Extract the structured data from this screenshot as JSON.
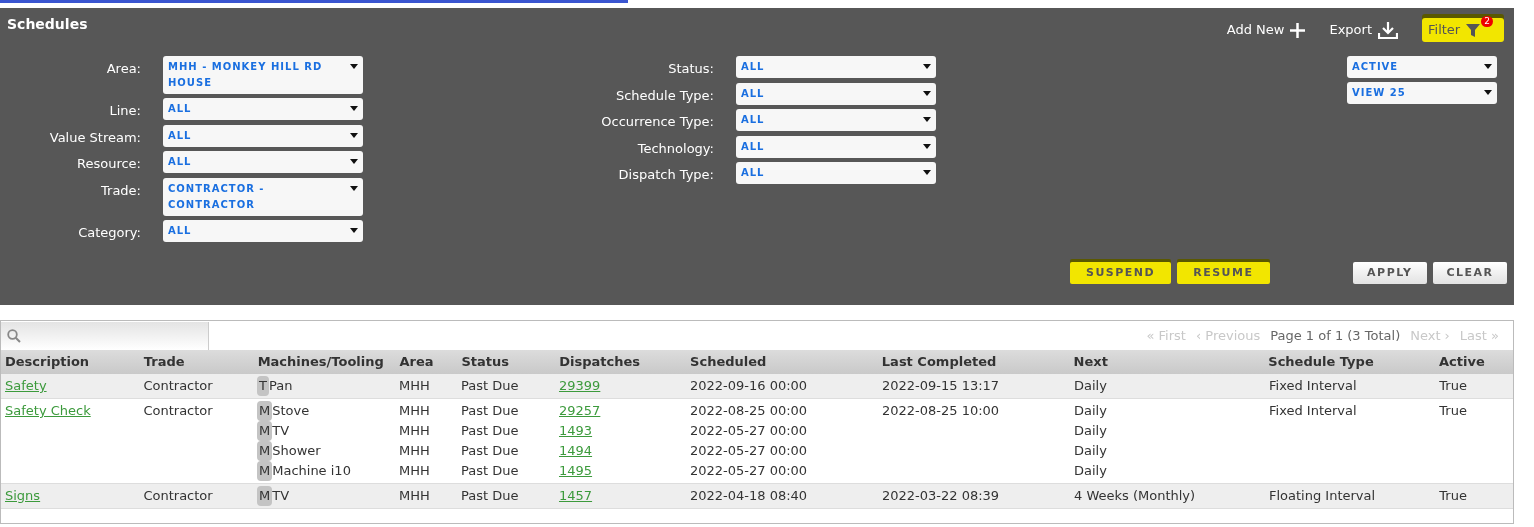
{
  "title": "Schedules",
  "actions": [
    {
      "label": "Add New",
      "kind": "add",
      "highlighted": false
    },
    {
      "label": "Export",
      "kind": "export",
      "highlighted": false
    },
    {
      "label": "Filter",
      "kind": "filter",
      "highlighted": true,
      "badge": "2"
    }
  ],
  "filters_left": [
    {
      "label": "Area:",
      "value": "MHH - MONKEY HILL RD HOUSE"
    },
    {
      "label": "Line:",
      "value": "ALL"
    },
    {
      "label": "Value Stream:",
      "value": "ALL"
    },
    {
      "label": "Resource:",
      "value": "ALL"
    },
    {
      "label": "Trade:",
      "value": "CONTRACTOR - CONTRACTOR"
    },
    {
      "label": "Category:",
      "value": "ALL"
    }
  ],
  "filters_middle": [
    {
      "label": "Status:",
      "value": "ALL"
    },
    {
      "label": "Schedule Type:",
      "value": "ALL"
    },
    {
      "label": "Occurrence Type:",
      "value": "ALL"
    },
    {
      "label": "Technology:",
      "value": "ALL"
    },
    {
      "label": "Dispatch Type:",
      "value": "ALL"
    }
  ],
  "filters_right": [
    {
      "value": "ACTIVE"
    },
    {
      "value": "VIEW 25"
    }
  ],
  "bulk_buttons": [
    {
      "label": "SUSPEND",
      "highlighted": true
    },
    {
      "label": "RESUME",
      "highlighted": true
    }
  ],
  "form_buttons": [
    {
      "label": "APPLY",
      "highlighted": false
    },
    {
      "label": "CLEAR",
      "highlighted": false
    }
  ],
  "pager": {
    "first": {
      "label": "« First",
      "disabled": true
    },
    "previous": {
      "label": "‹ Previous",
      "disabled": true
    },
    "info": "Page 1 of 1 (3 Total)",
    "next": {
      "label": "Next ›",
      "disabled": true
    },
    "last": {
      "label": "Last »",
      "disabled": true
    }
  },
  "table": {
    "columns": [
      "Description",
      "Trade",
      "Machines/Tooling",
      "Area",
      "Status",
      "Dispatches",
      "Scheduled",
      "Last Completed",
      "Next",
      "Schedule Type",
      "Active"
    ],
    "rows": [
      {
        "description": "Safety",
        "trade": "Contractor",
        "schedule_type": "Fixed Interval",
        "active": "True",
        "items": [
          {
            "badge": "T",
            "machine": "Pan",
            "area": "MHH",
            "status": "Past Due",
            "dispatch": "29399",
            "scheduled": "2022-09-16 00:00",
            "last_completed": "2022-09-15 13:17",
            "next": "Daily"
          }
        ]
      },
      {
        "description": "Safety Check",
        "trade": "Contractor",
        "schedule_type": "Fixed Interval",
        "active": "True",
        "items": [
          {
            "badge": "M",
            "machine": "Stove",
            "area": "MHH",
            "status": "Past Due",
            "dispatch": "29257",
            "scheduled": "2022-08-25 00:00",
            "last_completed": "2022-08-25 10:00",
            "next": "Daily"
          },
          {
            "badge": "M",
            "machine": "TV",
            "area": "MHH",
            "status": "Past Due",
            "dispatch": "1493",
            "scheduled": "2022-05-27 00:00",
            "next": "Daily"
          },
          {
            "badge": "M",
            "machine": "Shower",
            "area": "MHH",
            "status": "Past Due",
            "dispatch": "1494",
            "scheduled": "2022-05-27 00:00",
            "next": "Daily"
          },
          {
            "badge": "M",
            "machine": "Machine i10",
            "area": "MHH",
            "status": "Past Due",
            "dispatch": "1495",
            "scheduled": "2022-05-27 00:00",
            "next": "Daily"
          }
        ]
      },
      {
        "description": "Signs",
        "trade": "Contractor",
        "schedule_type": "Floating Interval",
        "active": "True",
        "items": [
          {
            "badge": "M",
            "machine": "TV",
            "area": "MHH",
            "status": "Past Due",
            "dispatch": "1457",
            "scheduled": "2022-04-18 08:40",
            "last_completed": "2022-03-22 08:39",
            "next": "4 Weeks (Monthly)"
          }
        ]
      }
    ]
  }
}
